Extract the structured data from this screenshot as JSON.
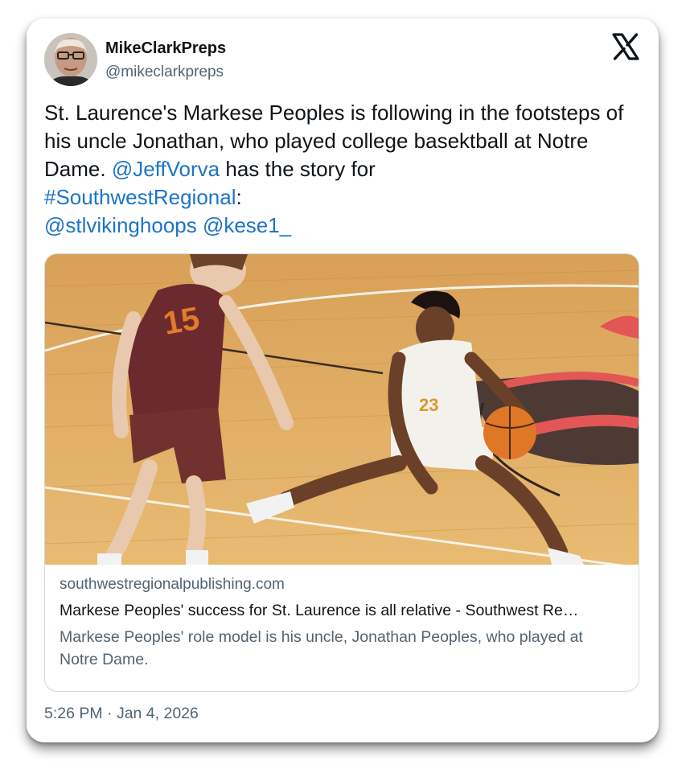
{
  "author": {
    "name": "MikeClarkPreps",
    "handle": "@mikeclarkpreps"
  },
  "tweet": {
    "text_1": "St. Laurence's Markese Peoples is following in the footsteps of his uncle Jonathan, who played college basektball at Notre Dame. ",
    "mention_1": "@JeffVorva",
    "text_2": " has the story for ",
    "hashtag": "#SouthwestRegional",
    "text_3": ":",
    "mention_2": "@stlvikinghoops",
    "mention_3": "@kese1_",
    "link_color": "#1d74c7"
  },
  "link_card": {
    "domain": "southwestregionalpublishing.com",
    "title": "Markese Peoples' success for St. Laurence is all relative - Southwest Re…",
    "description": "Markese Peoples' role model is his uncle, Jonathan Peoples, who played at Notre Dame.",
    "image_alt": "basketball-game-photo"
  },
  "timestamp": "5:26 PM · Jan 4, 2026",
  "icons": {
    "platform": "x-logo-icon"
  }
}
